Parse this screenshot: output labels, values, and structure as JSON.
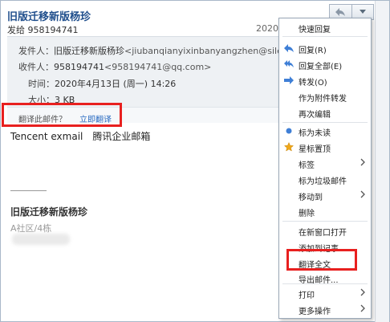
{
  "email": {
    "subject": "旧版迁移新版杨珍",
    "sender_line": "发给 958194741",
    "date_short": "2020-",
    "details": {
      "from_label": "发件人：",
      "from_name": "旧版迁移新版杨珍",
      "from_email": "<jiubanqianyixinbanyangzhen@silenceye",
      "to_label": "收件人：",
      "to_name": "958194741",
      "to_email": "<958194741@qq.com>",
      "time_label": "时间：",
      "time_value": "2020年4月13日 (周一) 14:26",
      "size_label": "大小：",
      "size_value": "3 KB"
    },
    "translate": {
      "prompt": "翻译此邮件？",
      "action": "立即翻译"
    },
    "body": {
      "line_1a": "Tencent exmail",
      "line_1b": "腾讯企业邮箱"
    },
    "signature": {
      "name": "旧版迁移新版杨珍",
      "address": "A社区/4栋"
    }
  },
  "toolbar": {
    "reply_icon": "reply-arrow-icon",
    "dropdown_icon": "chevron-down-icon"
  },
  "menu": {
    "items": [
      {
        "label": "快速回复",
        "icon": ""
      },
      {
        "label": "回复(R)",
        "icon": "reply-icon"
      },
      {
        "label": "回复全部(E)",
        "icon": "reply-all-icon"
      },
      {
        "label": "转发(O)",
        "icon": "forward-icon"
      },
      {
        "label": "作为附件转发",
        "icon": ""
      },
      {
        "label": "再次编辑",
        "icon": ""
      },
      {
        "label": "标为未读",
        "icon": "unread-dot-icon"
      },
      {
        "label": "星标置顶",
        "icon": "star-icon"
      },
      {
        "label": "标签",
        "icon": ""
      },
      {
        "label": "标为垃圾邮件",
        "icon": ""
      },
      {
        "label": "移动到",
        "icon": ""
      },
      {
        "label": "删除",
        "icon": ""
      },
      {
        "label": "在新窗口打开",
        "icon": ""
      },
      {
        "label": "添加到记事",
        "icon": ""
      },
      {
        "label": "翻译全文",
        "icon": ""
      },
      {
        "label": "导出邮件...",
        "icon": ""
      },
      {
        "label": "打印",
        "icon": ""
      },
      {
        "label": "更多操作",
        "icon": ""
      }
    ]
  },
  "colors": {
    "highlight_box": "#e8201f",
    "link": "#2a6bc1",
    "subject": "#1f4e8c",
    "menu_icon_blue": "#3f7fd6",
    "star": "#f0a81a"
  }
}
